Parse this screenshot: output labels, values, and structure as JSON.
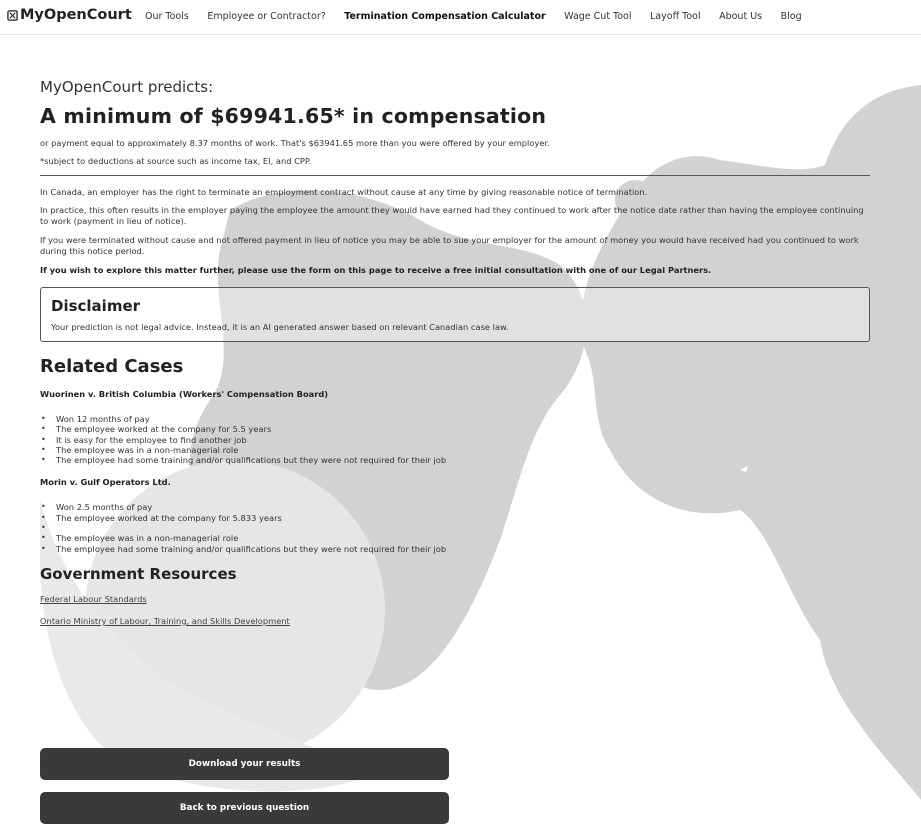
{
  "nav": {
    "logo": "MyOpenCourt",
    "links": [
      "Our Tools",
      "Employee or Contractor?",
      "Termination Compensation Calculator",
      "Wage Cut Tool",
      "Layoff Tool",
      "About Us",
      "Blog"
    ],
    "active_index": 2
  },
  "result": {
    "predicts": "MyOpenCourt predicts:",
    "headline": "A minimum of $69941.65* in compensation",
    "equivalent": "or payment equal to approximately 8.37 months of work. That's $63941.65 more than you were offered by your employer.",
    "footnote": "*subject to deductions at source such as income tax, EI, and CPP."
  },
  "explanation": [
    "In Canada, an employer has the right to terminate an employment contract without cause at any time by giving reasonable notice of termination.",
    "In practice, this often results in the employer paying the employee the amount they would have earned had they continued to work after the notice date rather than having the employee continuing to work (payment in lieu of notice).",
    "If you were terminated without cause and not offered payment in lieu of notice you may be able to sue your employer for the amount of money you would have received had you continued to work during this notice period.",
    "If you wish to explore this matter further, please use the form on this page to receive a free initial consultation with one of our Legal Partners."
  ],
  "disclaimer": {
    "title": "Disclaimer",
    "text": "Your prediction is not legal advice. Instead, it is an AI generated answer based on relevant Canadian case law."
  },
  "related": {
    "title": "Related Cases",
    "cases": [
      {
        "name": "Wuorinen v. British Columbia (Workers' Compensation Board)",
        "bullets": [
          "Won 12 months of pay",
          "The employee worked at the company for 5.5 years",
          "It is easy for the employee to find another job",
          "The employee was in a non-managerial role",
          "The employee had some training and/or qualifications but they were not required for their job"
        ]
      },
      {
        "name": "Morin v. Gulf Operators Ltd.",
        "bullets": [
          "Won 2.5 months of pay",
          "The employee worked at the company for 5.833 years",
          "",
          "The employee was in a non-managerial role",
          "The employee had some training and/or qualifications but they were not required for their job"
        ]
      }
    ]
  },
  "government": {
    "title": "Government Resources",
    "links": [
      "Federal Labour Standards",
      "Ontario Ministry of Labour, Training, and Skills Development"
    ]
  },
  "buttons": {
    "download": "Download your results",
    "back": "Back to previous question"
  },
  "colors": {
    "button_bg": "#3a3a3a",
    "blob": "#d2d2d2",
    "text": "#2d2d2d"
  }
}
